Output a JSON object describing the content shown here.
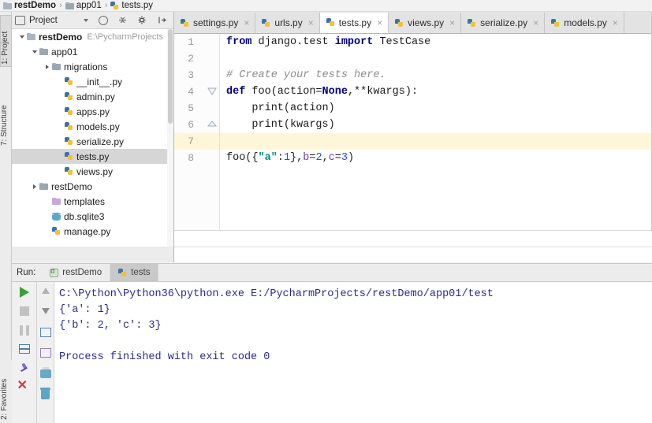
{
  "breadcrumb": {
    "items": [
      {
        "label": "restDemo",
        "icon": "folder-icon",
        "bold": true
      },
      {
        "label": "app01",
        "icon": "module-folder-icon",
        "bold": false
      },
      {
        "label": "tests.py",
        "icon": "python-file-icon",
        "bold": false
      }
    ],
    "separator": "›"
  },
  "left_strip": {
    "tabs": [
      {
        "label": "1: Project",
        "selected": true
      },
      {
        "label": "7: Structure",
        "selected": false
      }
    ],
    "favorites_label": "2: Favorites"
  },
  "project_panel": {
    "title": "Project",
    "toolbar_icons": [
      "chevron-down-icon",
      "target-icon",
      "collapse-all-icon",
      "gear-icon",
      "hide-icon"
    ],
    "tree": [
      {
        "label": "restDemo",
        "path": "E:\\PycharmProjects",
        "icon": "folder-icon",
        "indent": 0,
        "arrow": "down",
        "bold": true,
        "selected": false
      },
      {
        "label": "app01",
        "path": "",
        "icon": "module-folder-icon",
        "indent": 1,
        "arrow": "down",
        "bold": false,
        "selected": false
      },
      {
        "label": "migrations",
        "path": "",
        "icon": "module-folder-icon",
        "indent": 2,
        "arrow": "right",
        "bold": false,
        "selected": false
      },
      {
        "label": "__init__.py",
        "path": "",
        "icon": "python-file-icon",
        "indent": 3,
        "arrow": "none",
        "bold": false,
        "selected": false
      },
      {
        "label": "admin.py",
        "path": "",
        "icon": "python-file-icon",
        "indent": 3,
        "arrow": "none",
        "bold": false,
        "selected": false
      },
      {
        "label": "apps.py",
        "path": "",
        "icon": "python-file-icon",
        "indent": 3,
        "arrow": "none",
        "bold": false,
        "selected": false
      },
      {
        "label": "models.py",
        "path": "",
        "icon": "python-file-icon",
        "indent": 3,
        "arrow": "none",
        "bold": false,
        "selected": false
      },
      {
        "label": "serialize.py",
        "path": "",
        "icon": "python-file-icon",
        "indent": 3,
        "arrow": "none",
        "bold": false,
        "selected": false
      },
      {
        "label": "tests.py",
        "path": "",
        "icon": "python-file-icon",
        "indent": 3,
        "arrow": "none",
        "bold": false,
        "selected": true
      },
      {
        "label": "views.py",
        "path": "",
        "icon": "python-file-icon",
        "indent": 3,
        "arrow": "none",
        "bold": false,
        "selected": false
      },
      {
        "label": "restDemo",
        "path": "",
        "icon": "module-folder-icon",
        "indent": 1,
        "arrow": "right",
        "bold": false,
        "selected": false
      },
      {
        "label": "templates",
        "path": "",
        "icon": "templates-folder-icon",
        "indent": 2,
        "arrow": "none",
        "bold": false,
        "selected": false
      },
      {
        "label": "db.sqlite3",
        "path": "",
        "icon": "database-icon",
        "indent": 2,
        "arrow": "none",
        "bold": false,
        "selected": false
      },
      {
        "label": "manage.py",
        "path": "",
        "icon": "python-file-icon",
        "indent": 2,
        "arrow": "none",
        "bold": false,
        "selected": false
      }
    ]
  },
  "editor_tabs": [
    {
      "label": "settings.py",
      "active": false,
      "close": "×"
    },
    {
      "label": "urls.py",
      "active": false,
      "close": "×"
    },
    {
      "label": "tests.py",
      "active": true,
      "close": "×"
    },
    {
      "label": "views.py",
      "active": false,
      "close": "×"
    },
    {
      "label": "serialize.py",
      "active": false,
      "close": "×"
    },
    {
      "label": "models.py",
      "active": false,
      "close": "×"
    }
  ],
  "editor": {
    "filename": "tests.py",
    "current_line": 7,
    "lines": [
      {
        "num": "1",
        "tokens": [
          {
            "t": "from ",
            "c": "kw"
          },
          {
            "t": "django.test ",
            "c": "plain"
          },
          {
            "t": "import ",
            "c": "kw"
          },
          {
            "t": "TestCase",
            "c": "plain"
          }
        ]
      },
      {
        "num": "2",
        "tokens": []
      },
      {
        "num": "3",
        "tokens": [
          {
            "t": "# Create your tests here.",
            "c": "cm"
          }
        ]
      },
      {
        "num": "4",
        "tokens": [
          {
            "t": "def ",
            "c": "kw"
          },
          {
            "t": "foo(action=",
            "c": "plain"
          },
          {
            "t": "None",
            "c": "kw"
          },
          {
            "t": ",**kwargs):",
            "c": "plain"
          }
        ]
      },
      {
        "num": "5",
        "tokens": [
          {
            "t": "    print(action)",
            "c": "plain"
          }
        ]
      },
      {
        "num": "6",
        "tokens": [
          {
            "t": "    print(kwargs)",
            "c": "plain"
          }
        ]
      },
      {
        "num": "7",
        "tokens": []
      },
      {
        "num": "8",
        "tokens": [
          {
            "t": "foo({",
            "c": "plain"
          },
          {
            "t": "\"a\"",
            "c": "str"
          },
          {
            "t": ":",
            "c": "plain"
          },
          {
            "t": "1",
            "c": "num"
          },
          {
            "t": "},",
            "c": "plain"
          },
          {
            "t": "b",
            "c": "kwarg"
          },
          {
            "t": "=",
            "c": "plain"
          },
          {
            "t": "2",
            "c": "num"
          },
          {
            "t": ",",
            "c": "plain"
          },
          {
            "t": "c",
            "c": "kwarg"
          },
          {
            "t": "=",
            "c": "plain"
          },
          {
            "t": "3",
            "c": "num"
          },
          {
            "t": ")",
            "c": "plain"
          }
        ]
      }
    ]
  },
  "run_panel": {
    "label": "Run:",
    "tabs": [
      {
        "label": "restDemo",
        "active": false,
        "icon": "django-run-icon"
      },
      {
        "label": "tests",
        "active": true,
        "icon": "python-run-icon"
      }
    ],
    "toolbar_primary": [
      "run-icon",
      "stop-icon",
      "pause-icon",
      "layout-icon",
      "pin-icon",
      "close-icon"
    ],
    "toolbar_secondary": [
      "arrow-up-icon",
      "arrow-down-icon",
      "soft-wrap-icon",
      "scroll-to-end-icon",
      "print-icon",
      "trash-icon"
    ],
    "console_lines": [
      "C:\\Python\\Python36\\python.exe E:/PycharmProjects/restDemo/app01/test",
      "{'a': 1}",
      "{'b': 2, 'c': 3}",
      "",
      "Process finished with exit code 0"
    ]
  },
  "colors": {
    "keyword": "#000080",
    "comment": "#8c8c8c",
    "string": "#008b8b",
    "number": "#2a4fd6",
    "kwarg": "#7a3fa0",
    "console_text": "#2b2b8f",
    "current_line_bg": "#fdf6d8",
    "selection_bg": "#d6d6d6"
  }
}
